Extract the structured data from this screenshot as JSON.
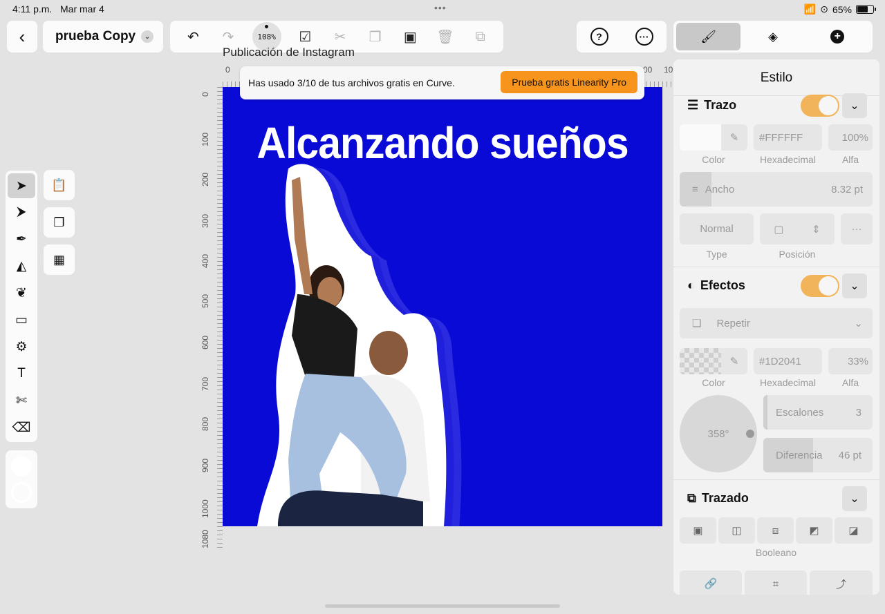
{
  "status": {
    "time": "4:11 p.m.",
    "date": "Mar mar 4",
    "dots": "•••",
    "battery": "65%"
  },
  "doc": {
    "name": "prueba Copy",
    "artboard_title": "Publicación de Instagram",
    "zoom": "108%"
  },
  "headline": "Alcanzando sueños",
  "banner": {
    "text": "Has usado 3/10 de tus archivos gratis en Curve.",
    "cta": "Prueba gratis Linearity Pro"
  },
  "ruler": {
    "top": [
      "0",
      "00",
      "10"
    ],
    "left": [
      "0",
      "100",
      "200",
      "300",
      "400",
      "500",
      "600",
      "700",
      "800",
      "900",
      "1000",
      "1080"
    ]
  },
  "panel": {
    "title": "Estilo",
    "stroke": {
      "title": "Trazo",
      "color_label": "Color",
      "hex": "#FFFFFF",
      "hex_label": "Hexadecimal",
      "alpha": "100%",
      "alpha_label": "Alfa",
      "width_label": "Ancho",
      "width_value": "8.32 pt",
      "type_value": "Normal",
      "type_label": "Type",
      "position_label": "Posición",
      "more": "···"
    },
    "effects": {
      "title": "Efectos",
      "mode": "Repetir",
      "color_label": "Color",
      "hex": "#1D2041",
      "hex_label": "Hexadecimal",
      "alpha": "33%",
      "alpha_label": "Alfa",
      "angle": "358°",
      "steps_label": "Escalones",
      "steps_value": "3",
      "diff_label": "Diferencia",
      "diff_value": "46 pt"
    },
    "path": {
      "title": "Trazado",
      "boolean_label": "Booleano"
    }
  },
  "colors": {
    "canvas": "#0A0AD6",
    "accent": "#F7941D",
    "toggle": "#F2B45A"
  }
}
